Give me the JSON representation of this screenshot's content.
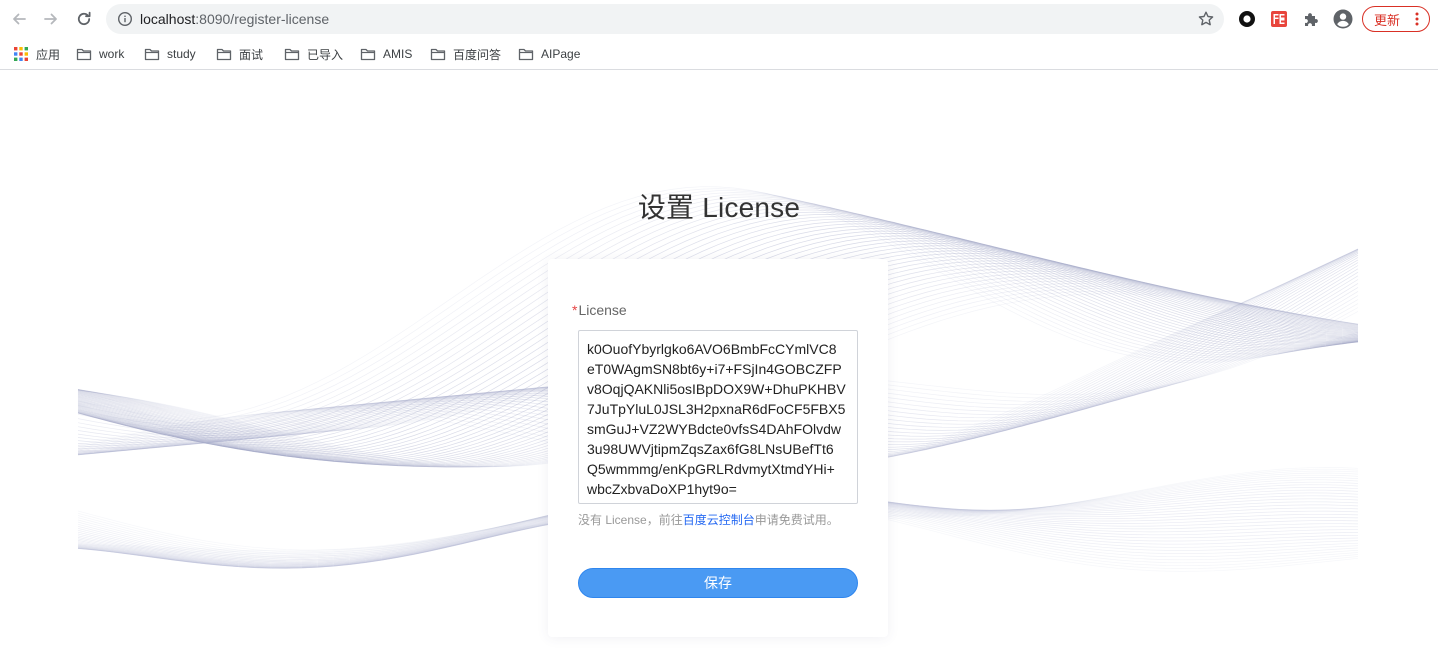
{
  "browser": {
    "url_host": "localhost",
    "url_path": ":8090/register-license",
    "update_label": "更新"
  },
  "bookmarks": [
    {
      "label": "应用",
      "icon": "apps-grid-icon"
    },
    {
      "label": "work",
      "icon": "folder-icon"
    },
    {
      "label": "study",
      "icon": "folder-icon"
    },
    {
      "label": "面试",
      "icon": "folder-icon"
    },
    {
      "label": "已导入",
      "icon": "folder-icon"
    },
    {
      "label": "AMIS",
      "icon": "folder-icon"
    },
    {
      "label": "百度问答",
      "icon": "folder-icon"
    },
    {
      "label": "AIPage",
      "icon": "folder-icon"
    }
  ],
  "page": {
    "title": "设置 License",
    "form": {
      "required_mark": "*",
      "license_label": "License",
      "license_value": "k0OuofYbyrlgko6AVO6BmbFcCYmlVC8\neT0WAgmSN8bt6y+i7+FSjIn4GOBCZFP\nv8OqjQAKNli5osIBpDOX9W+DhuPKHBV\n7JuTpYluL0JSL3H2pxnaR6dFoCF5FBX5\nsmGuJ+VZ2WYBdcte0vfsS4DAhFOlvdw\n3u98UWVjtipmZqsZax6fG8LNsUBefTt6\nQ5wmmmg/enKpGRLRdvmytXtmdYHi+\nwbcZxbvaDoXP1hyt9o=",
      "help_prefix": "没有 License，前往",
      "help_link": "百度云控制台",
      "help_suffix": "申请免费试用。",
      "save_label": "保存"
    }
  },
  "colors": {
    "primary_button": "#4a9af3",
    "link": "#2468f2",
    "required": "#e64545",
    "update_red": "#d93025"
  }
}
